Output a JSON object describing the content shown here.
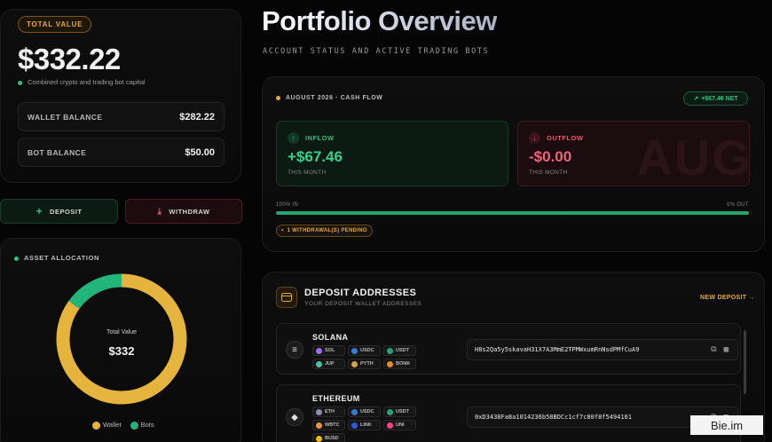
{
  "summary": {
    "total_label": "TOTAL VALUE",
    "total_amount": "$332.22",
    "total_sub": "Combined crypto and trading bot capital",
    "wallet_label": "WALLET BALANCE",
    "wallet_value": "$282.22",
    "bot_label": "BOT BALANCE",
    "bot_value": "$50.00"
  },
  "actions": {
    "deposit_label": "DEPOSIT",
    "withdraw_label": "WITHDRAW"
  },
  "allocation": {
    "label": "ASSET ALLOCATION",
    "center_label": "Total Value",
    "center_value": "$332",
    "legend": [
      {
        "name": "Wallet",
        "color": "#e5b43c"
      },
      {
        "name": "Bots",
        "color": "#22b57a"
      }
    ]
  },
  "chart_data": {
    "type": "pie",
    "categories": [
      "Wallet",
      "Bots"
    ],
    "values": [
      282.22,
      50.0
    ],
    "colors": [
      "#e5b43c",
      "#22b57a"
    ],
    "title": "",
    "center_label": "Total Value",
    "center_value": "$332"
  },
  "header": {
    "title": "Portfolio Overview",
    "subtitle": "ACCOUNT STATUS AND ACTIVE TRADING BOTS"
  },
  "cashflow": {
    "label": "AUGUST 2026 · CASH FLOW",
    "net_badge": "+$67.46 NET",
    "inflow_label": "INFLOW",
    "inflow_amount": "+$67.46",
    "inflow_caption": "THIS MONTH",
    "outflow_label": "OUTFLOW",
    "outflow_amount": "-$0.00",
    "outflow_caption": "THIS MONTH",
    "watermark": "AUG",
    "bar_left_label": "100% IN",
    "bar_right_label": "0% OUT",
    "in_fraction": 1.0,
    "pending_label": "1 WITHDRAWAL(S) PENDING"
  },
  "deposit_addresses": {
    "title": "DEPOSIT ADDRESSES",
    "subtitle": "YOUR DEPOSIT WALLET ADDRESSES",
    "new_deposit": "NEW DEPOSIT →",
    "chains": [
      {
        "name": "SOLANA",
        "address": "H8s2Qa5y5skavaH31X7A3MmE2TPMWxumRnNsdPMfCuA9",
        "tokens": [
          {
            "sym": "SOL",
            "color": "#9b6cf0"
          },
          {
            "sym": "USDC",
            "color": "#3a78d4"
          },
          {
            "sym": "USDT",
            "color": "#26a17b"
          },
          {
            "sym": "JUP",
            "color": "#4cc1a0"
          },
          {
            "sym": "PYTH",
            "color": "#d6a24a"
          },
          {
            "sym": "BONK",
            "color": "#e58a2a"
          }
        ]
      },
      {
        "name": "ETHEREUM",
        "address": "0xD3438Fa8a1014236b58BDCc1cf7c80f8f5494161",
        "tokens": [
          {
            "sym": "ETH",
            "color": "#8a92b2"
          },
          {
            "sym": "USDC",
            "color": "#3a78d4"
          },
          {
            "sym": "USDT",
            "color": "#26a17b"
          },
          {
            "sym": "WBTC",
            "color": "#f09242"
          },
          {
            "sym": "LINK",
            "color": "#2a5ada"
          },
          {
            "sym": "UNI",
            "color": "#ff3d8b"
          },
          {
            "sym": "BUSD",
            "color": "#f0b90b"
          }
        ]
      }
    ]
  },
  "badge": "Bie.im"
}
